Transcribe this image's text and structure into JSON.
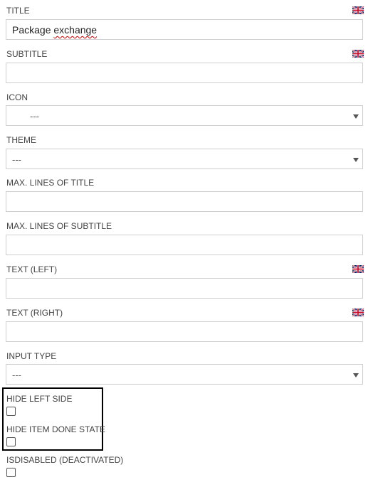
{
  "fields": {
    "title": {
      "label": "TITLE",
      "value_main": "Package ",
      "value_misspelled": "exchange"
    },
    "subtitle": {
      "label": "SUBTITLE",
      "value": ""
    },
    "icon": {
      "label": "ICON",
      "selected": "---"
    },
    "theme": {
      "label": "THEME",
      "selected": "---"
    },
    "max_lines_title": {
      "label": "MAX. LINES OF TITLE",
      "value": ""
    },
    "max_lines_subtitle": {
      "label": "MAX. LINES OF SUBTITLE",
      "value": ""
    },
    "text_left": {
      "label": "TEXT (LEFT)",
      "value": ""
    },
    "text_right": {
      "label": "TEXT (RIGHT)",
      "value": ""
    },
    "input_type": {
      "label": "INPUT TYPE",
      "selected": "---"
    }
  },
  "checkboxes": {
    "hide_left_side": {
      "label": "HIDE LEFT SIDE",
      "checked": false
    },
    "hide_item_done_state": {
      "label": "HIDE ITEM DONE STATE",
      "checked": false
    },
    "isdisabled": {
      "label": "ISDISABLED (DEACTIVATED)",
      "checked": false
    }
  },
  "icons": {
    "language_flag": "uk-flag-icon",
    "dropdown_caret": "chevron-down-icon"
  },
  "colors": {
    "border": "#cfcfcf",
    "label": "#444444",
    "highlight_border": "#000000",
    "spellcheck_underline": "#d40000"
  }
}
